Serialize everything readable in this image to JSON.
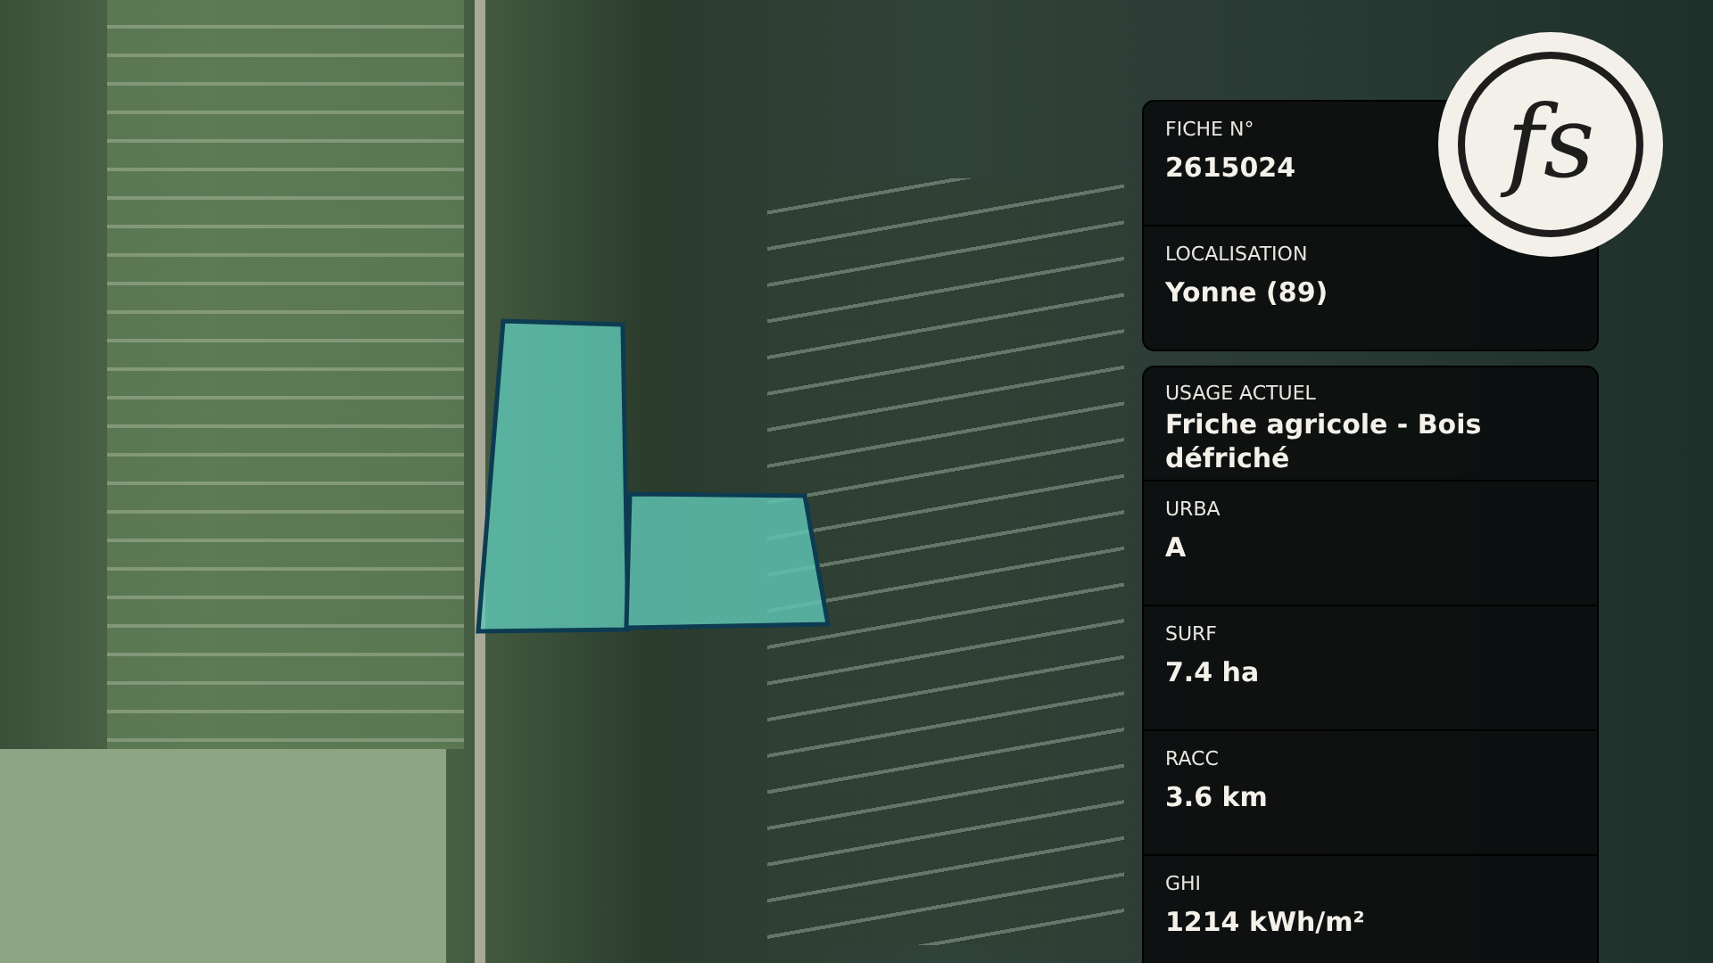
{
  "logo": {
    "text": "fs"
  },
  "summary_card": [
    {
      "label": "FICHE N°",
      "value": "2615024"
    },
    {
      "label": "LOCALISATION",
      "value": "Yonne (89)"
    }
  ],
  "details_card": [
    {
      "label": "USAGE ACTUEL",
      "value": "Friche agricole - Bois défriché"
    },
    {
      "label": "URBA",
      "value": "A"
    },
    {
      "label": "SURF",
      "value": "7.4 ha"
    },
    {
      "label": "RACC",
      "value": "3.6 km"
    },
    {
      "label": "GHI",
      "value": "1214 kWh/m²"
    }
  ]
}
